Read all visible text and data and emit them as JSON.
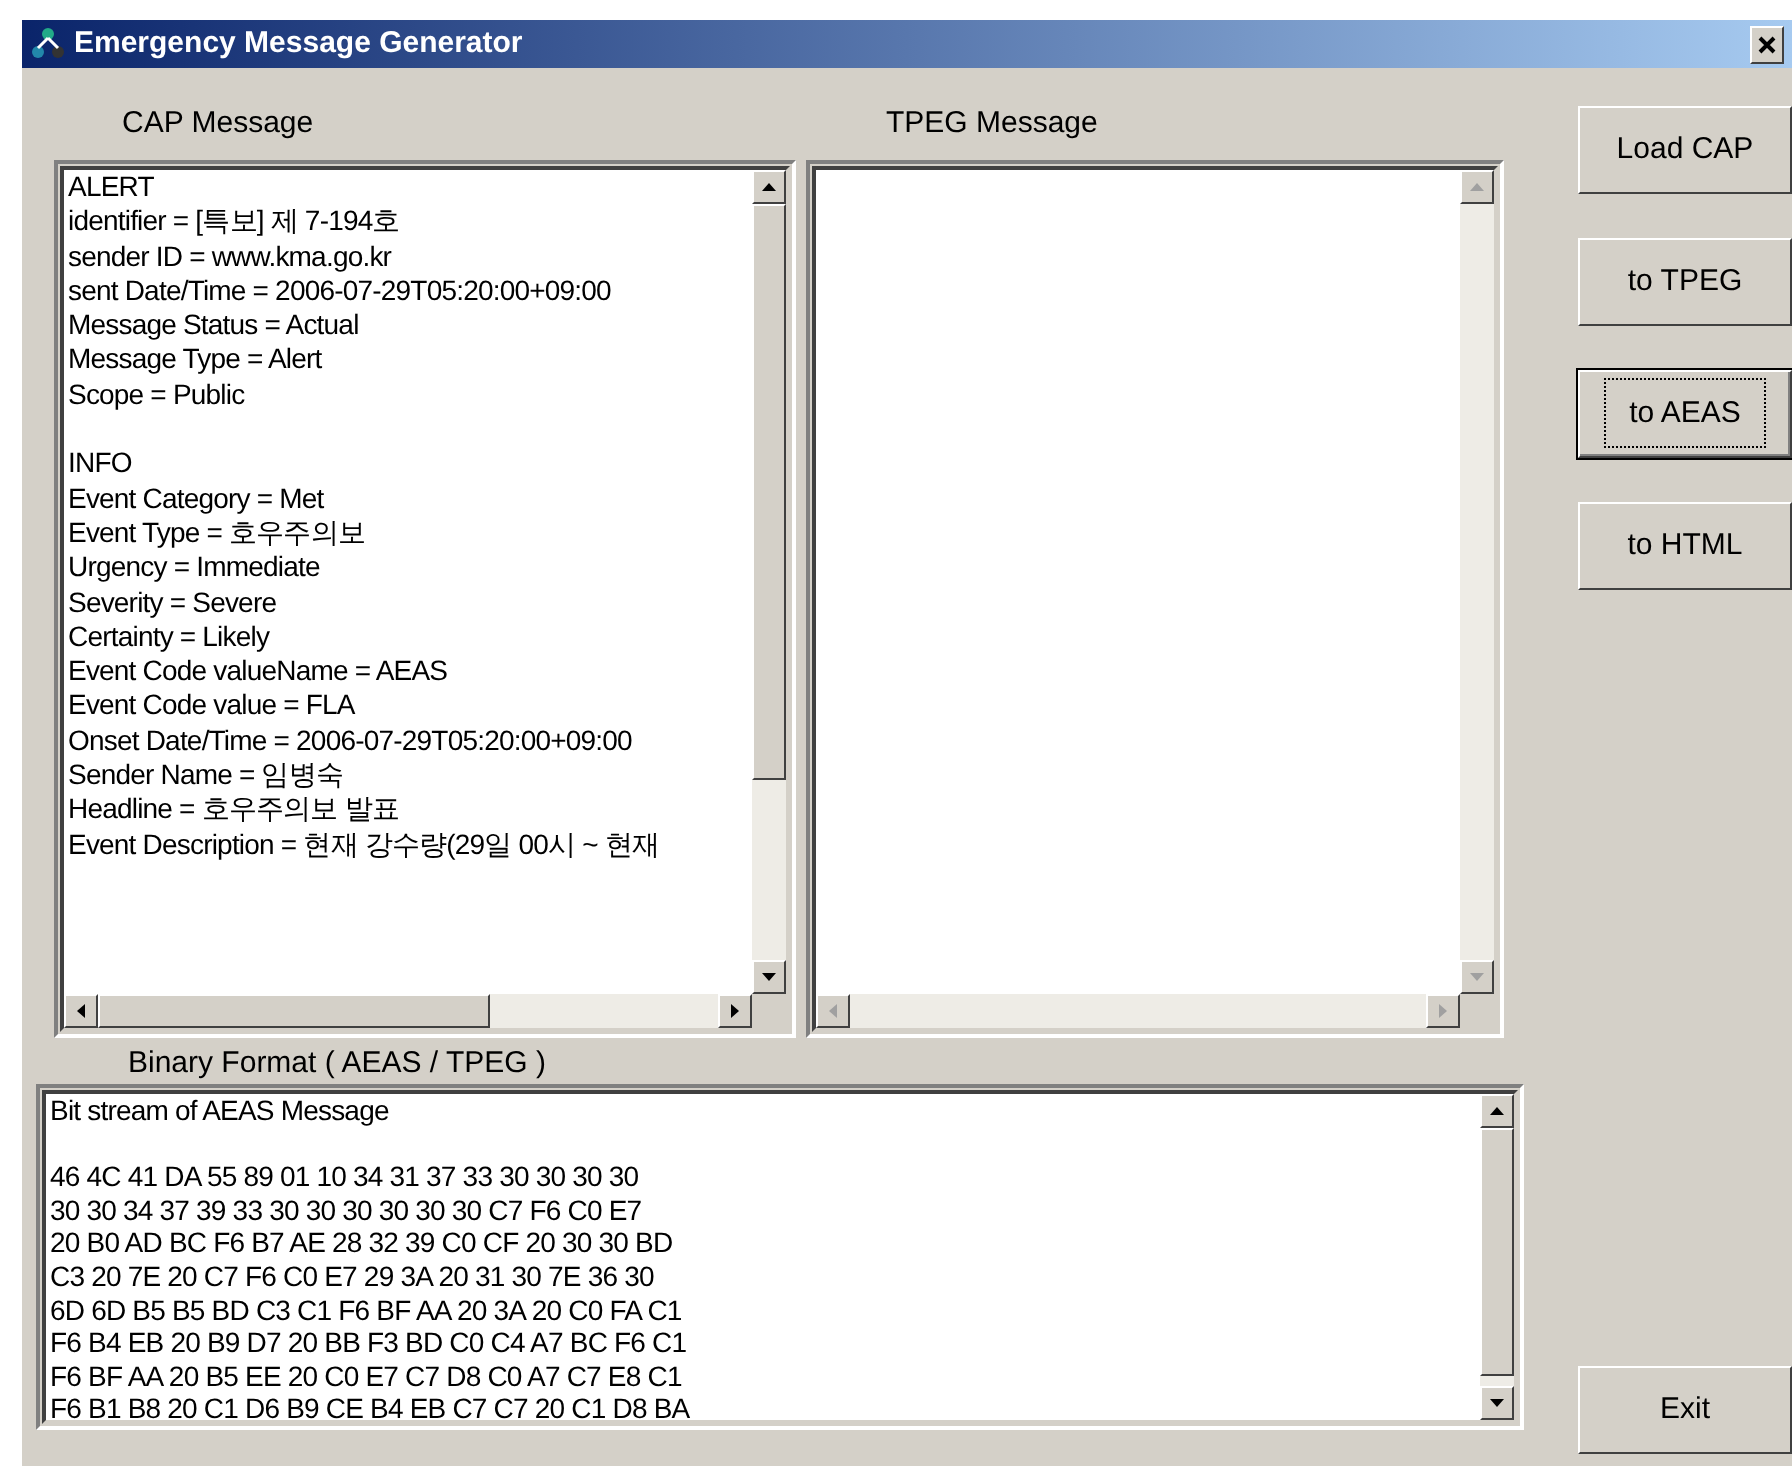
{
  "window": {
    "title": "Emergency Message Generator"
  },
  "cap": {
    "label": "CAP Message",
    "scroll_disabled": false,
    "sections": [
      [
        "ALERT",
        "identifier = [특보] 제 7-194호",
        "sender ID = www.kma.go.kr",
        "sent Date/Time = 2006-07-29T05:20:00+09:00",
        "Message Status = Actual",
        "Message Type = Alert",
        "Scope = Public"
      ],
      [
        "INFO",
        "Event Category = Met",
        "Event Type = 호우주의보",
        "Urgency = Immediate",
        "Severity = Severe",
        "Certainty = Likely",
        "Event Code valueName = AEAS",
        "Event Code value = FLA",
        "Onset Date/Time = 2006-07-29T05:20:00+09:00",
        "Sender Name = 임병숙",
        "Headline = 호우주의보 발표",
        "Event Description = 현재 강수량(29일 00시 ~ 현재"
      ]
    ]
  },
  "tpeg": {
    "label": "TPEG Message",
    "scroll_disabled": true
  },
  "binary": {
    "label": "Binary Format ( AEAS / TPEG )",
    "sections": [
      [
        "Bit stream of AEAS Message"
      ],
      [
        "46 4C 41 DA 55 89 01 10 34 31 37 33 30 30 30 30",
        "30 30 34 37 39 33 30 30 30 30 30 30 C7 F6 C0 E7",
        "20 B0 AD BC F6 B7 AE 28 32 39 C0 CF 20 30 30 BD",
        "C3 20 7E 20 C7 F6 C0 E7 29 3A 20 31 30 7E 36 30",
        "6D 6D B5 B5 BD C3 C1 F6 BF AA 20 3A 20 C0 FA C1",
        "F6 B4 EB 20 B9 D7 20 BB F3 BD C0 C4 A7 BC F6 C1",
        "F6 BF AA 20 B5 EE 20 C0 E7 C7 D8 C0 A7 C7 E8 C1",
        "F6 B1 B8 20 C1 D6 B9 CE B4 EB C7 C7 20 C1 D8 BA"
      ]
    ]
  },
  "buttons": [
    {
      "label": "Load CAP",
      "focused": false
    },
    {
      "label": "to TPEG",
      "focused": false
    },
    {
      "label": "to AEAS",
      "focused": true
    },
    {
      "label": "to HTML",
      "focused": false
    }
  ],
  "exit_button": {
    "label": "Exit",
    "focused": false
  }
}
